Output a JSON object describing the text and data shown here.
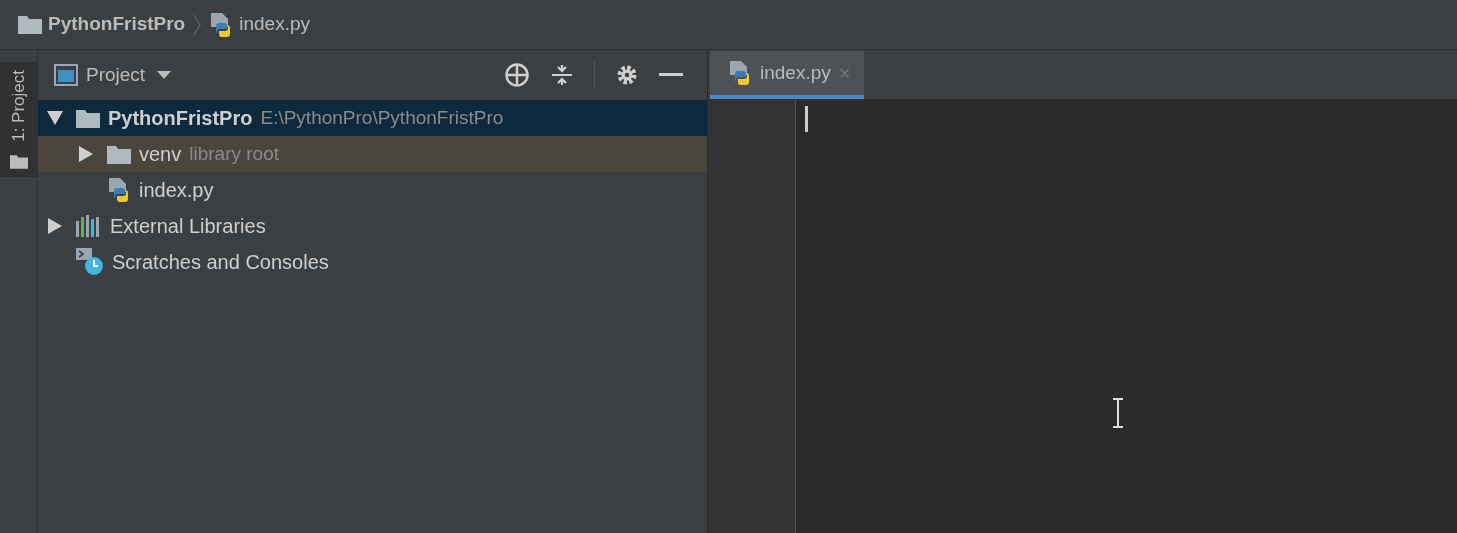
{
  "breadcrumb": [
    {
      "kind": "folder",
      "label": "PythonFristPro"
    },
    {
      "kind": "python",
      "label": "index.py"
    }
  ],
  "tool_window_strip": {
    "tabs": [
      {
        "label": "1: Project",
        "selected": true
      }
    ]
  },
  "project_panel": {
    "view_selector": "Project",
    "tree": [
      {
        "kind": "folder",
        "label": "PythonFristPro",
        "note": "E:\\PythonPro\\PythonFristPro",
        "bold": true,
        "expanded": true,
        "selected": true,
        "highlighted": false,
        "children": [
          {
            "kind": "folder",
            "label": "venv",
            "note": "library root",
            "bold": false,
            "expanded": false,
            "selected": false,
            "highlighted": true
          },
          {
            "kind": "python",
            "label": "index.py",
            "bold": false,
            "selected": false,
            "highlighted": false
          }
        ]
      },
      {
        "kind": "libraries",
        "label": "External Libraries",
        "bold": false,
        "expanded": false,
        "selected": false,
        "highlighted": false
      },
      {
        "kind": "scratches",
        "label": "Scratches and Consoles",
        "bold": false,
        "selected": false,
        "highlighted": false
      }
    ]
  },
  "editor": {
    "tabs": [
      {
        "kind": "python",
        "label": "index.py",
        "close": "×",
        "selected": true
      }
    ]
  }
}
